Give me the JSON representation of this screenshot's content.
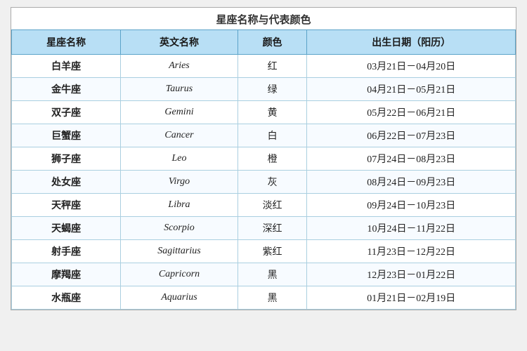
{
  "title": "星座名称与代表颜色",
  "table": {
    "headers": [
      "星座名称",
      "英文名称",
      "颜色",
      "出生日期（阳历）"
    ],
    "rows": [
      {
        "chinese": "白羊座",
        "english": "Aries",
        "color": "红",
        "dates": "03月21日－04月20日"
      },
      {
        "chinese": "金牛座",
        "english": "Taurus",
        "color": "绿",
        "dates": "04月21日－05月21日"
      },
      {
        "chinese": "双子座",
        "english": "Gemini",
        "color": "黄",
        "dates": "05月22日－06月21日"
      },
      {
        "chinese": "巨蟹座",
        "english": "Cancer",
        "color": "白",
        "dates": "06月22日－07月23日"
      },
      {
        "chinese": "狮子座",
        "english": "Leo",
        "color": "橙",
        "dates": "07月24日－08月23日"
      },
      {
        "chinese": "处女座",
        "english": "Virgo",
        "color": "灰",
        "dates": "08月24日－09月23日"
      },
      {
        "chinese": "天秤座",
        "english": "Libra",
        "color": "淡红",
        "dates": "09月24日－10月23日"
      },
      {
        "chinese": "天蝎座",
        "english": "Scorpio",
        "color": "深红",
        "dates": "10月24日－11月22日"
      },
      {
        "chinese": "射手座",
        "english": "Sagittarius",
        "color": "紫红",
        "dates": "11月23日－12月22日"
      },
      {
        "chinese": "摩羯座",
        "english": "Capricorn",
        "color": "黑",
        "dates": "12月23日－01月22日"
      },
      {
        "chinese": "水瓶座",
        "english": "Aquarius",
        "color": "黑",
        "dates": "01月21日－02月19日"
      }
    ]
  }
}
